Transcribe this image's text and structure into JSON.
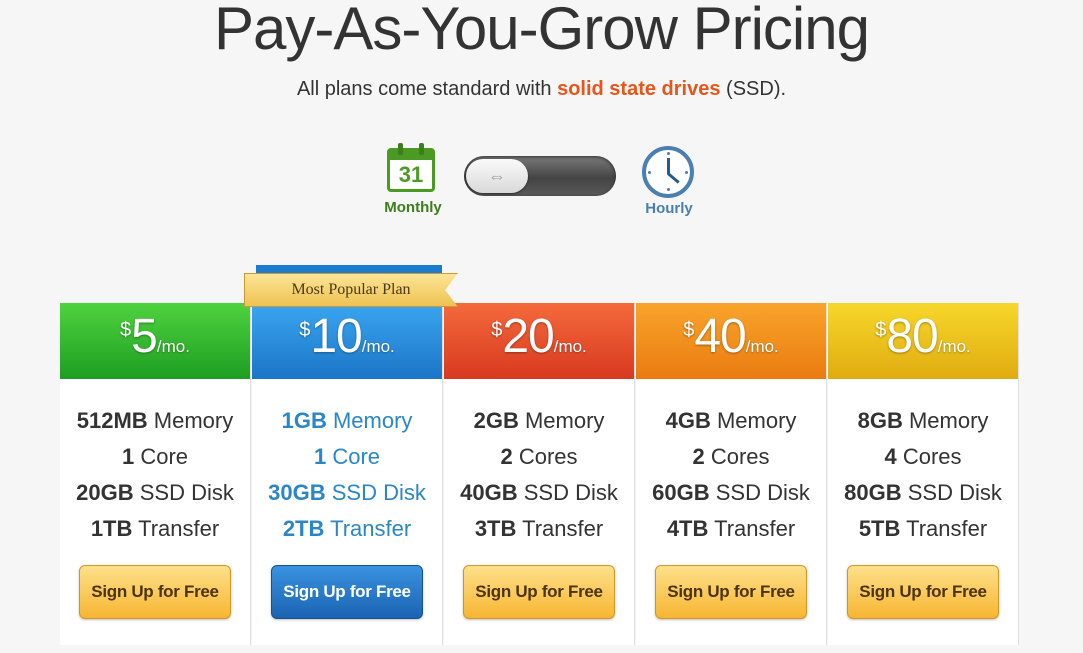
{
  "header": {
    "title": "Pay-As-You-Grow Pricing",
    "subtitle_pre": "All plans come standard with ",
    "subtitle_highlight": "solid state drives",
    "subtitle_post": " (SSD)."
  },
  "billing_toggle": {
    "monthly_label": "Monthly",
    "hourly_label": "Hourly",
    "calendar_day": "31",
    "selected": "Monthly"
  },
  "ribbon": {
    "label": "Most Popular Plan"
  },
  "plans": [
    {
      "currency": "$",
      "amount": "5",
      "period": "/mo.",
      "features": [
        {
          "v": "512MB",
          "l": " Memory"
        },
        {
          "v": "1",
          "l": " Core"
        },
        {
          "v": "20GB",
          "l": " SSD Disk"
        },
        {
          "v": "1TB",
          "l": " Transfer"
        }
      ],
      "button": "Sign Up for Free",
      "color": "#1e9e22"
    },
    {
      "currency": "$",
      "amount": "10",
      "period": "/mo.",
      "features": [
        {
          "v": "1GB",
          "l": " Memory"
        },
        {
          "v": "1",
          "l": " Core"
        },
        {
          "v": "30GB",
          "l": " SSD Disk"
        },
        {
          "v": "2TB",
          "l": " Transfer"
        }
      ],
      "button": "Sign Up for Free",
      "color": "#1c75c8"
    },
    {
      "currency": "$",
      "amount": "20",
      "period": "/mo.",
      "features": [
        {
          "v": "2GB",
          "l": " Memory"
        },
        {
          "v": "2",
          "l": " Cores"
        },
        {
          "v": "40GB",
          "l": " SSD Disk"
        },
        {
          "v": "3TB",
          "l": " Transfer"
        }
      ],
      "button": "Sign Up for Free",
      "color": "#d8391f"
    },
    {
      "currency": "$",
      "amount": "40",
      "period": "/mo.",
      "features": [
        {
          "v": "4GB",
          "l": " Memory"
        },
        {
          "v": "2",
          "l": " Cores"
        },
        {
          "v": "60GB",
          "l": " SSD Disk"
        },
        {
          "v": "4TB",
          "l": " Transfer"
        }
      ],
      "button": "Sign Up for Free",
      "color": "#ea7b10"
    },
    {
      "currency": "$",
      "amount": "80",
      "period": "/mo.",
      "features": [
        {
          "v": "8GB",
          "l": " Memory"
        },
        {
          "v": "4",
          "l": " Cores"
        },
        {
          "v": "80GB",
          "l": " SSD Disk"
        },
        {
          "v": "5TB",
          "l": " Transfer"
        }
      ],
      "button": "Sign Up for Free",
      "color": "#e0ac10"
    }
  ]
}
